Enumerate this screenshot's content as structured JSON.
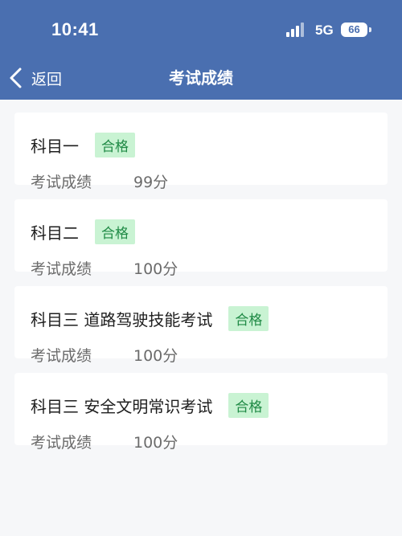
{
  "status_bar": {
    "time": "10:41",
    "network": "5G",
    "battery": "66",
    "icons": [
      "signal-icon",
      "battery-icon"
    ]
  },
  "nav": {
    "back_label": "返回",
    "back_icon": "chevron-left-icon",
    "title": "考试成绩"
  },
  "colors": {
    "header_bg": "#4a6fb0",
    "badge_bg": "#c9f3d3",
    "badge_text": "#1f8a45",
    "page_bg": "#f6f7f9"
  },
  "results": [
    {
      "subject": "科目一",
      "status": "合格",
      "score_label": "考试成绩",
      "score": "99分"
    },
    {
      "subject": "科目二",
      "status": "合格",
      "score_label": "考试成绩",
      "score": "100分"
    },
    {
      "subject": "科目三 道路驾驶技能考试",
      "status": "合格",
      "score_label": "考试成绩",
      "score": "100分"
    },
    {
      "subject": "科目三 安全文明常识考试",
      "status": "合格",
      "score_label": "考试成绩",
      "score": "100分"
    }
  ]
}
